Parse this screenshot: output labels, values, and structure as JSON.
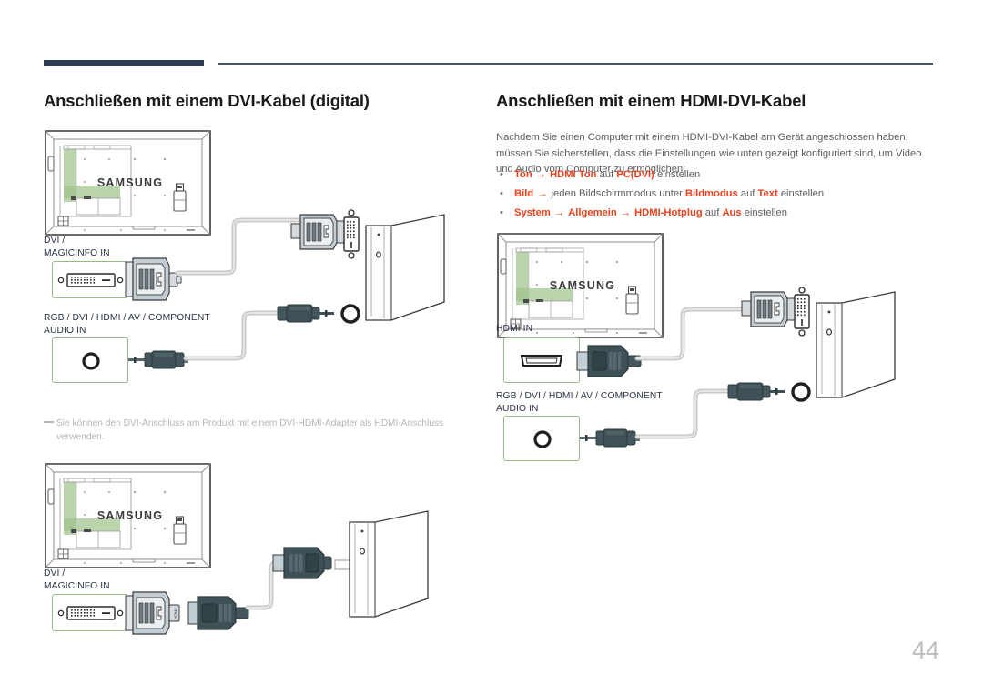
{
  "page": {
    "number": "44"
  },
  "left_section": {
    "title": "Anschließen mit einem DVI-Kabel (digital)",
    "note": {
      "line1": "Sie können den DVI-Anschluss am Produkt mit einem DVI-HDMI-Adapter als HDMI-Anschluss",
      "line2": "verwenden."
    },
    "diagram1": {
      "tv_brand": "SAMSUNG",
      "port1_label_line1": "DVI /",
      "port1_label_line2": "MAGICINFO IN",
      "port2_label_line1": "RGB / DVI / HDMI / AV / COMPONENT",
      "port2_label_line2": "AUDIO IN"
    },
    "diagram2": {
      "tv_brand": "SAMSUNG",
      "port1_label_line1": "DVI /",
      "port1_label_line2": "MAGICINFO IN",
      "adapter_mark": "HDMI"
    }
  },
  "right_section": {
    "title": "Anschließen mit einem HDMI-DVI-Kabel",
    "intro": "Nachdem Sie einen Computer mit einem HDMI-DVI-Kabel am Gerät angeschlossen haben, müssen Sie sicherstellen, dass die Einstellungen wie unten gezeigt konfiguriert sind, um Video und Audio vom Computer zu ermöglichen:",
    "bullets": [
      {
        "dot": "•",
        "parts": [
          {
            "text": "Ton",
            "style": "hl"
          },
          {
            "text": "→",
            "style": "arw"
          },
          {
            "text": "HDMI Ton",
            "style": "hl"
          },
          {
            "text": "auf",
            "style": "plain"
          },
          {
            "text": "PC(DVI)",
            "style": "hl"
          },
          {
            "text": "einstellen",
            "style": "plain"
          }
        ]
      },
      {
        "dot": "•",
        "parts": [
          {
            "text": "Bild",
            "style": "hl"
          },
          {
            "text": "→",
            "style": "arw"
          },
          {
            "text": "jeden Bildschirmmodus unter",
            "style": "plain"
          },
          {
            "text": "Bildmodus",
            "style": "hl"
          },
          {
            "text": "auf",
            "style": "plain"
          },
          {
            "text": "Text",
            "style": "hl"
          },
          {
            "text": "einstellen",
            "style": "plain"
          }
        ]
      },
      {
        "dot": "•",
        "parts": [
          {
            "text": "System",
            "style": "hl"
          },
          {
            "text": "→",
            "style": "arw"
          },
          {
            "text": "Allgemein",
            "style": "hl"
          },
          {
            "text": "→",
            "style": "arw"
          },
          {
            "text": "HDMI-Hotplug",
            "style": "hl"
          },
          {
            "text": "auf",
            "style": "plain"
          },
          {
            "text": "Aus",
            "style": "hl"
          },
          {
            "text": "einstellen",
            "style": "plain"
          }
        ]
      }
    ],
    "diagram": {
      "tv_brand": "SAMSUNG",
      "port1_label": "HDMI IN",
      "port2_label_line1": "RGB / DVI / HDMI / AV / COMPONENT",
      "port2_label_line2": "AUDIO IN"
    }
  },
  "colors": {
    "rule_dark": "#2f3a56",
    "rule_thin": "#4a4f6b",
    "heading": "#1a1a1a",
    "body_text": "#5d5d5d",
    "accent_red": "#e8411b",
    "port_border_green": "#9bbb85",
    "label_navy": "#2b3347",
    "note_gray": "#b6b6b6",
    "page_number_gray": "#bdbdbd",
    "cable_gray": "#c9c9c9",
    "connector_dark": "#3e4f52",
    "connector_light": "#c3cdd4"
  }
}
